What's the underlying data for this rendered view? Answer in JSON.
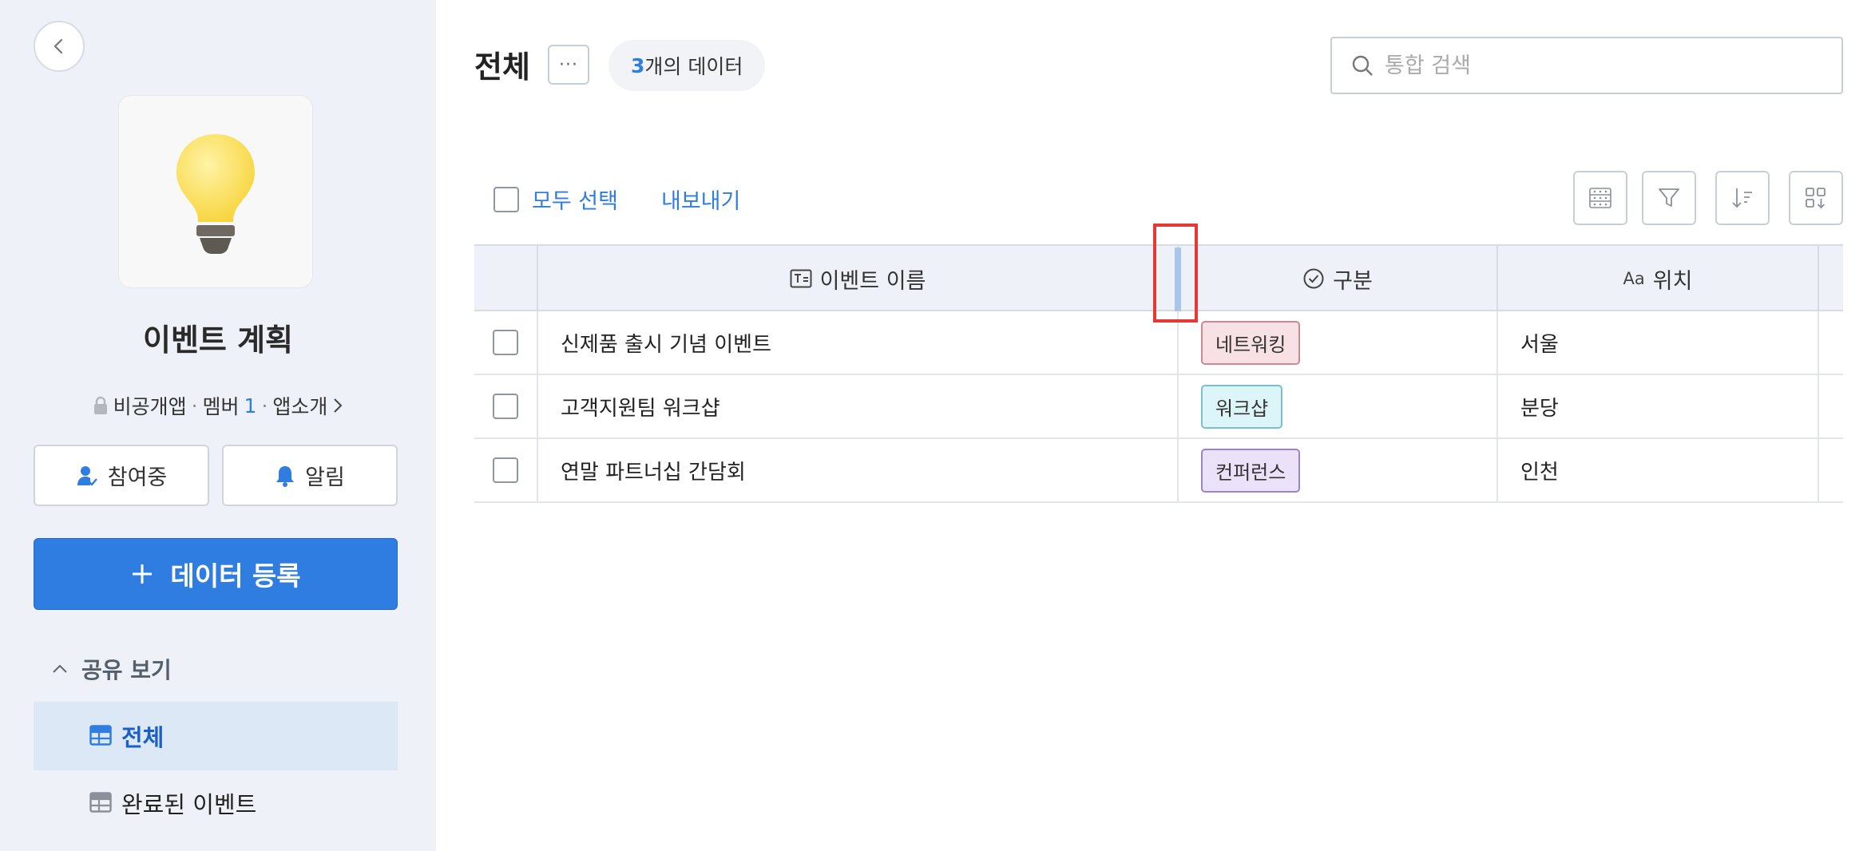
{
  "sidebar": {
    "app_title": "이벤트 계획",
    "meta": {
      "privacy": "비공개앱",
      "member_label": "멤버",
      "member_count": "1",
      "app_intro": "앱소개"
    },
    "participating_label": "참여중",
    "alert_label": "알림",
    "register_label": "데이터 등록",
    "section_label": "공유 보기",
    "views": [
      {
        "label": "전체",
        "active": true
      },
      {
        "label": "완료된 이벤트",
        "active": false
      }
    ]
  },
  "header": {
    "title": "전체",
    "more_label": "···",
    "count_number": "3",
    "count_suffix": "개의 데이터",
    "search_placeholder": "통합 검색"
  },
  "toolbar": {
    "select_all_label": "모두 선택",
    "export_label": "내보내기"
  },
  "table": {
    "columns": [
      {
        "label": "이벤트 이름",
        "icon": "text-field-icon"
      },
      {
        "label": "구분",
        "icon": "check-circle-icon"
      },
      {
        "label": "위치",
        "icon": "text-aa-icon",
        "icon_text": "Aa"
      }
    ],
    "rows": [
      {
        "name": "신제품 출시 기념 이벤트",
        "category": "네트워킹",
        "location": "서울"
      },
      {
        "name": "고객지원팀 워크샵",
        "category": "워크샵",
        "location": "분당"
      },
      {
        "name": "연말 파트너십 간담회",
        "category": "컨퍼런스",
        "location": "인천"
      }
    ]
  },
  "tag_colors": {
    "네트워킹": {
      "bg": "#f7e1e4",
      "border": "#c98a94",
      "text": "#333333"
    },
    "워크샵": {
      "bg": "#dcf5f8",
      "border": "#7bbfca",
      "text": "#333333"
    },
    "컨퍼런스": {
      "bg": "#ebe1f8",
      "border": "#9b84c8",
      "text": "#333333"
    }
  },
  "accent_color": "#2f7de1"
}
